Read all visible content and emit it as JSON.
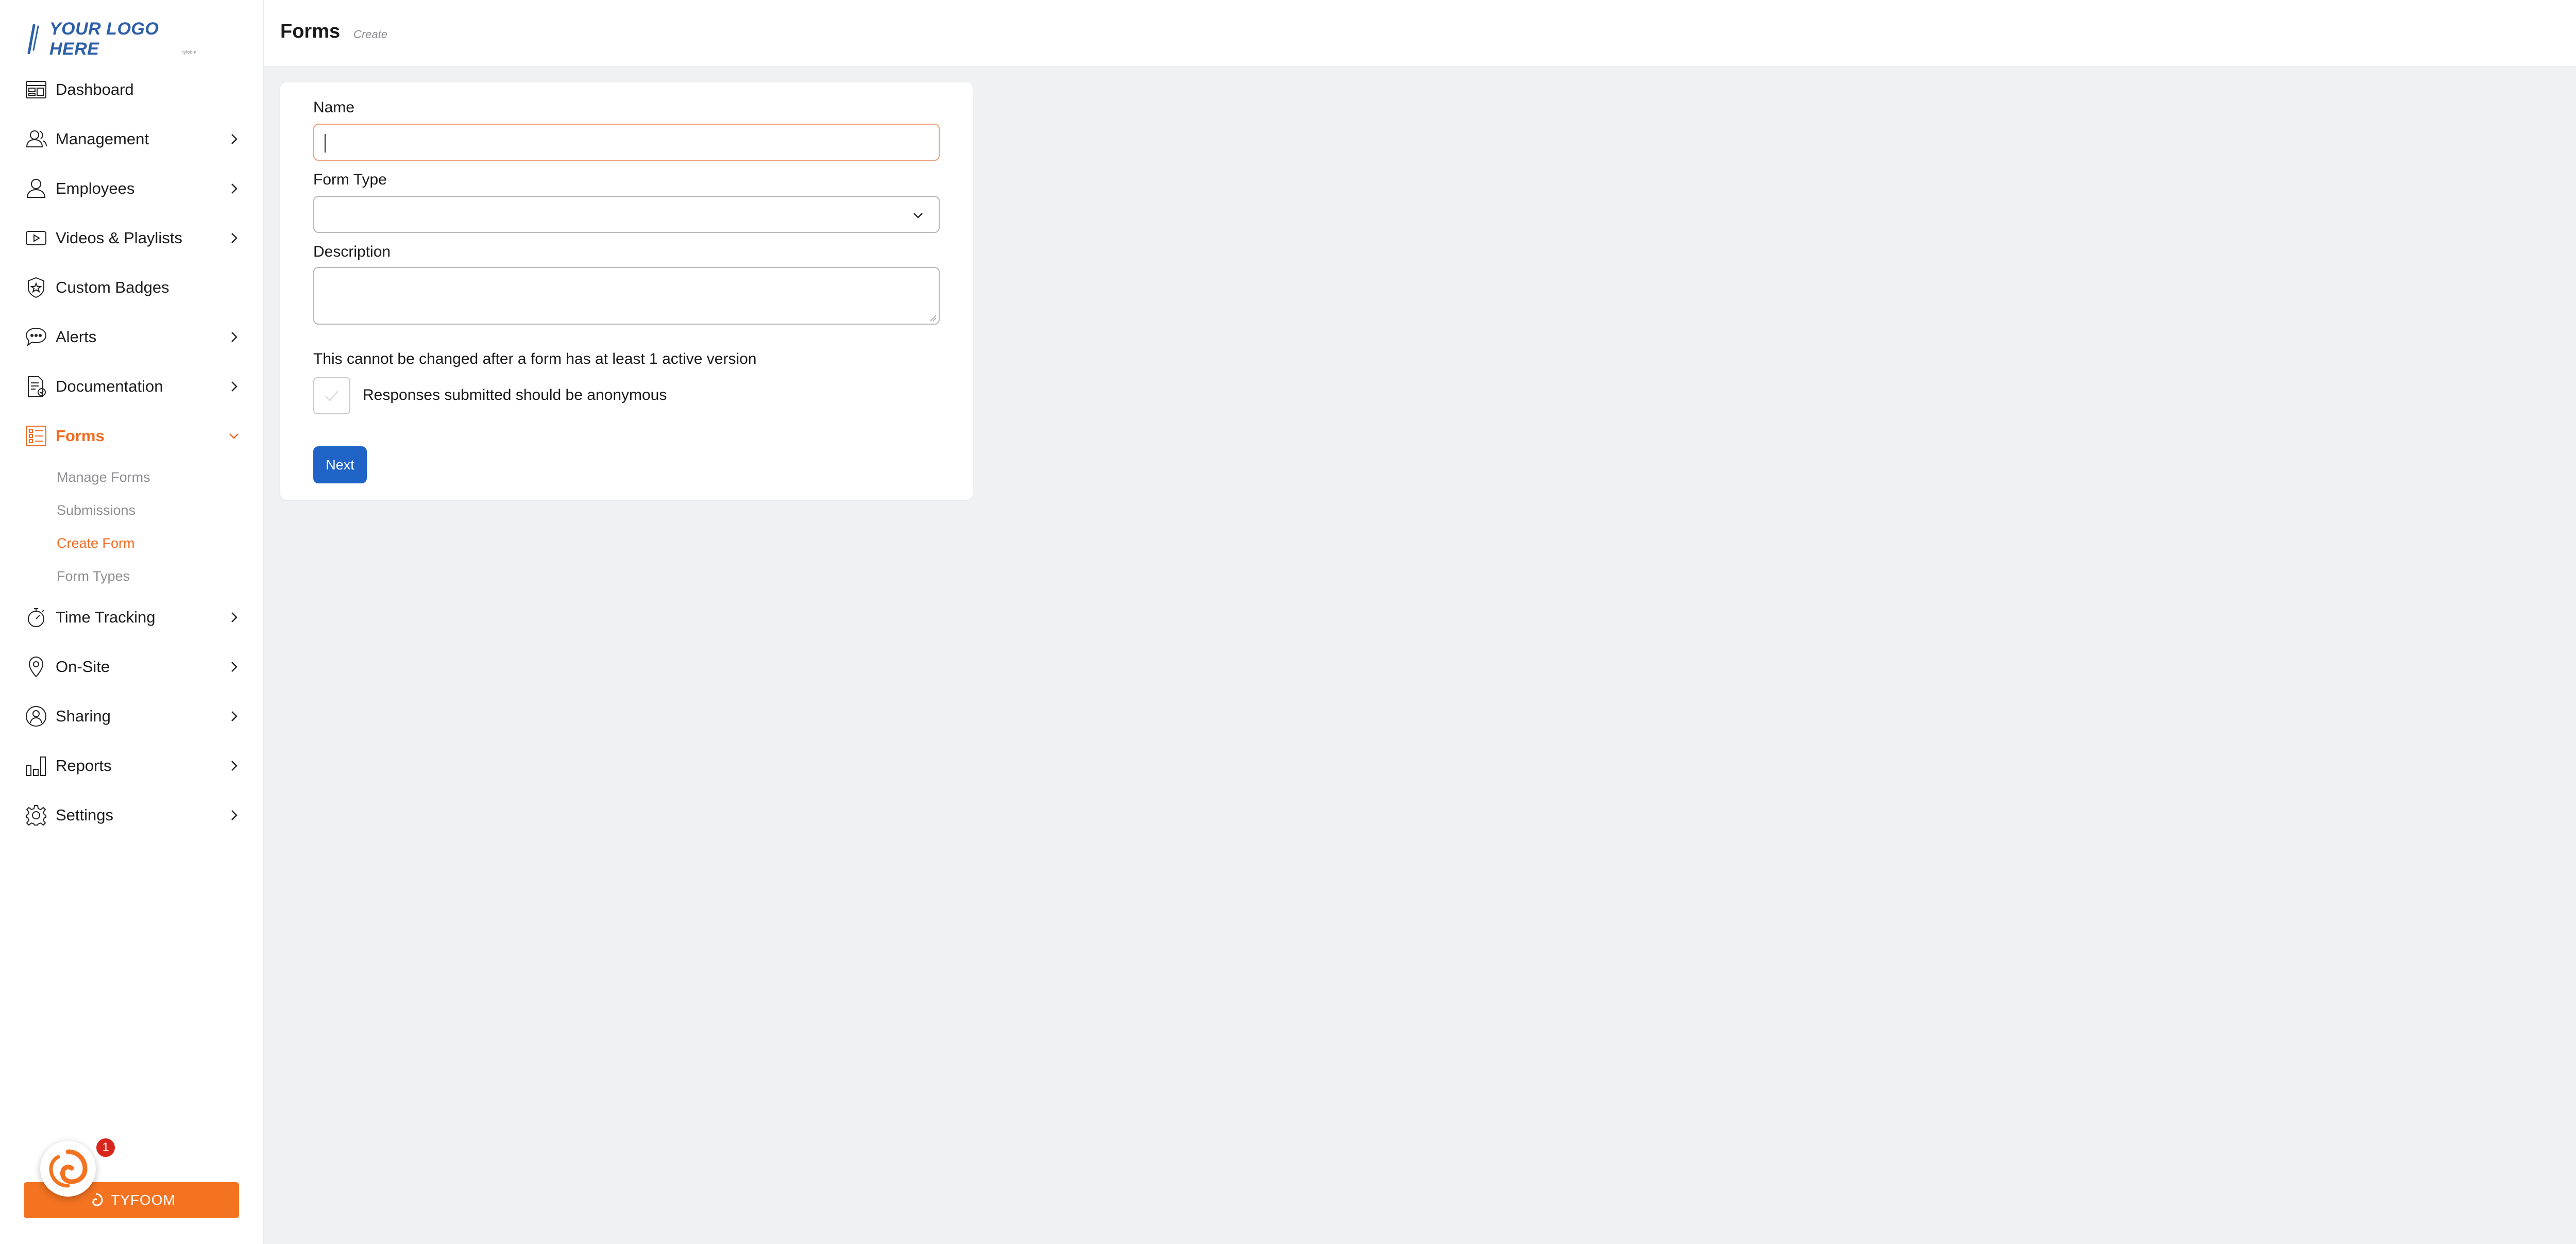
{
  "logo": {
    "text": "YOUR LOGO HERE",
    "sub": "tyfoom"
  },
  "header": {
    "title": "Forms",
    "subtitle": "Create"
  },
  "sidebar": {
    "items": [
      {
        "label": "Dashboard",
        "icon": "dashboard-icon",
        "has_chevron": false
      },
      {
        "label": "Management",
        "icon": "users-icon",
        "has_chevron": true
      },
      {
        "label": "Employees",
        "icon": "user-icon",
        "has_chevron": true
      },
      {
        "label": "Videos & Playlists",
        "icon": "video-icon",
        "has_chevron": true
      },
      {
        "label": "Custom Badges",
        "icon": "badge-icon",
        "has_chevron": false
      },
      {
        "label": "Alerts",
        "icon": "chat-bubble-icon",
        "has_chevron": true
      },
      {
        "label": "Documentation",
        "icon": "document-icon",
        "has_chevron": true
      },
      {
        "label": "Forms",
        "icon": "form-list-icon",
        "has_chevron": true,
        "active": true
      },
      {
        "label": "Time Tracking",
        "icon": "stopwatch-icon",
        "has_chevron": true
      },
      {
        "label": "On-Site",
        "icon": "location-pin-icon",
        "has_chevron": true
      },
      {
        "label": "Sharing",
        "icon": "share-user-icon",
        "has_chevron": true
      },
      {
        "label": "Reports",
        "icon": "bar-chart-icon",
        "has_chevron": true
      },
      {
        "label": "Settings",
        "icon": "gear-icon",
        "has_chevron": true
      }
    ],
    "forms_subitems": [
      {
        "label": "Manage Forms"
      },
      {
        "label": "Submissions"
      },
      {
        "label": "Create Form",
        "active": true
      },
      {
        "label": "Form Types"
      }
    ],
    "tyfoom": {
      "label": "TYFOOM",
      "notification_count": "1"
    }
  },
  "form": {
    "name_label": "Name",
    "name_value": "",
    "form_type_label": "Form Type",
    "form_type_value": "",
    "description_label": "Description",
    "description_value": "",
    "anonymous_note": "This cannot be changed after a form has at least 1 active version",
    "anonymous_label": "Responses submitted should be anonymous",
    "anonymous_checked": false,
    "next_label": "Next"
  },
  "colors": {
    "accent": "#f26a21",
    "primary_button": "#1f63c7",
    "logo_blue": "#2c5fa8",
    "background": "#f0f1f3"
  }
}
